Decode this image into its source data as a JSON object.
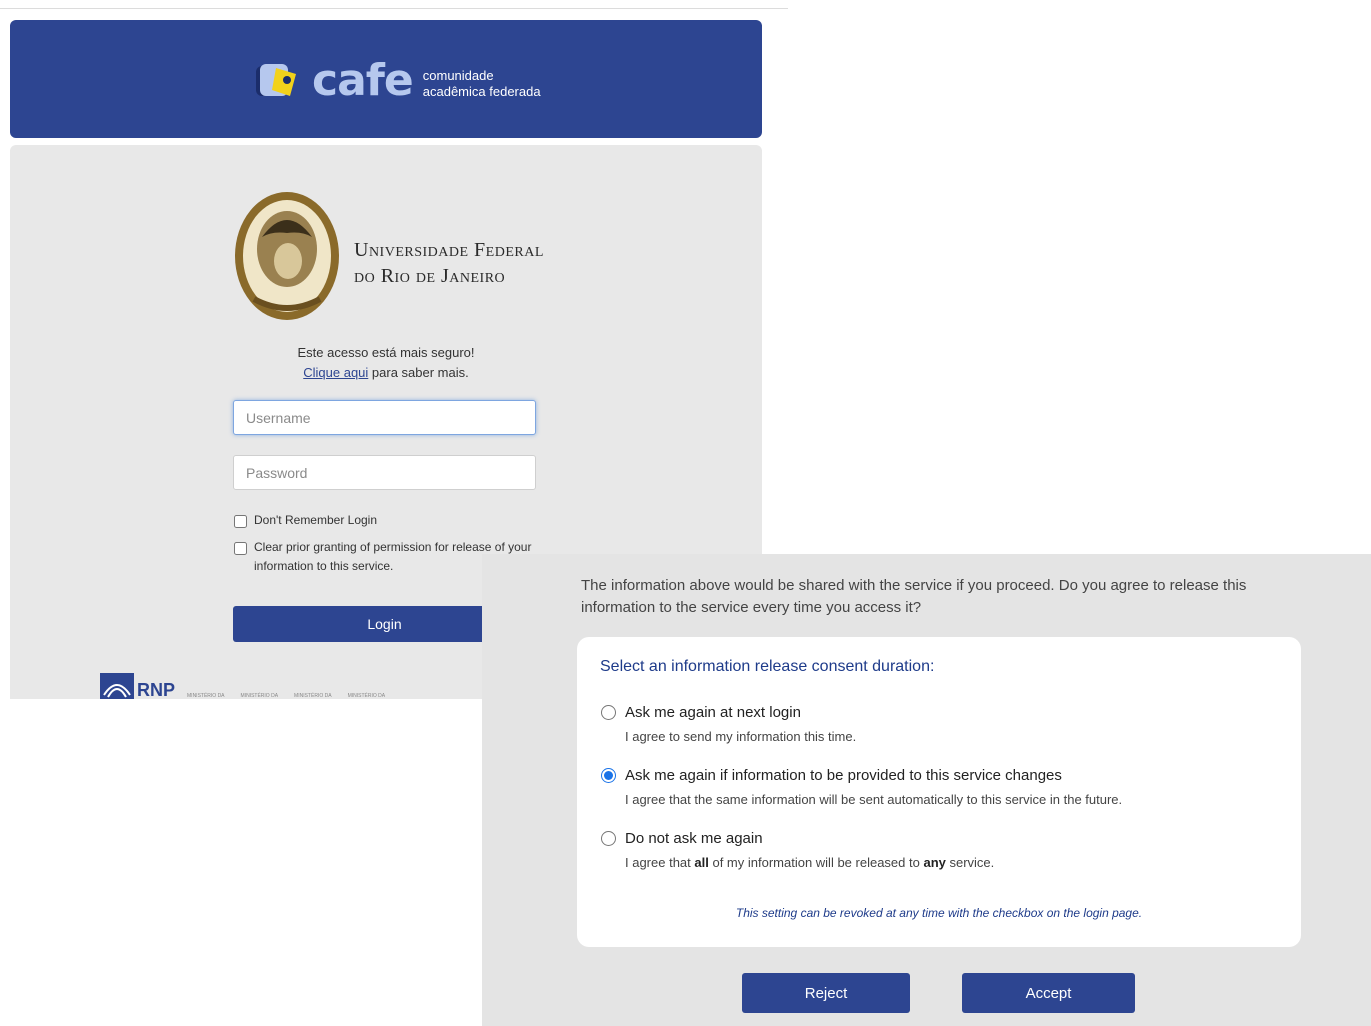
{
  "header": {
    "logo_word": "cafe",
    "logo_sub_1": "comunidade",
    "logo_sub_2": "acadêmica federada"
  },
  "university": {
    "name_line_1": "Universidade Federal",
    "name_line_2": "do Rio de Janeiro"
  },
  "login": {
    "secure_text": "Este acesso está mais seguro!",
    "learn_more_link": "Clique aqui",
    "learn_more_rest": " para saber mais.",
    "username_placeholder": "Username",
    "password_placeholder": "Password",
    "dont_remember_label": "Don't Remember Login",
    "clear_prior_label_1": "Clear prior granting of permission for release of your",
    "clear_prior_label_2": "information to this service.",
    "login_button": "Login"
  },
  "footer": {
    "rnp_label": "RNP",
    "ministries": [
      "MINISTÉRIO DA",
      "MINISTÉRIO DA",
      "MINISTÉRIO DA",
      "MINISTÉRIO DA"
    ]
  },
  "consent": {
    "intro_line_1": "The information above would be shared with the service if you proceed. Do you agree to release this",
    "intro_line_2": "information to the service every time you access it?",
    "card_title": "Select an information release consent duration:",
    "options": [
      {
        "label": "Ask me again at next login",
        "description": "I agree to send my information this time.",
        "selected": false
      },
      {
        "label": "Ask me again if information to be provided to this service changes",
        "description": "I agree that the same information will be sent automatically to this service in the future.",
        "selected": true
      },
      {
        "label": "Do not ask me again",
        "desc_a": "I agree that ",
        "desc_b": "all",
        "desc_c": " of my information will be released to ",
        "desc_d": "any",
        "desc_e": " service.",
        "selected": false
      }
    ],
    "note": "This setting can be revoked at any time with the checkbox on the login page.",
    "reject_button": "Reject",
    "accept_button": "Accept"
  },
  "colors": {
    "brand_blue": "#2d4591",
    "title_blue": "#1e3b8a",
    "panel_gray": "#e8e8e8",
    "radio_blue": "#1a73e8"
  }
}
